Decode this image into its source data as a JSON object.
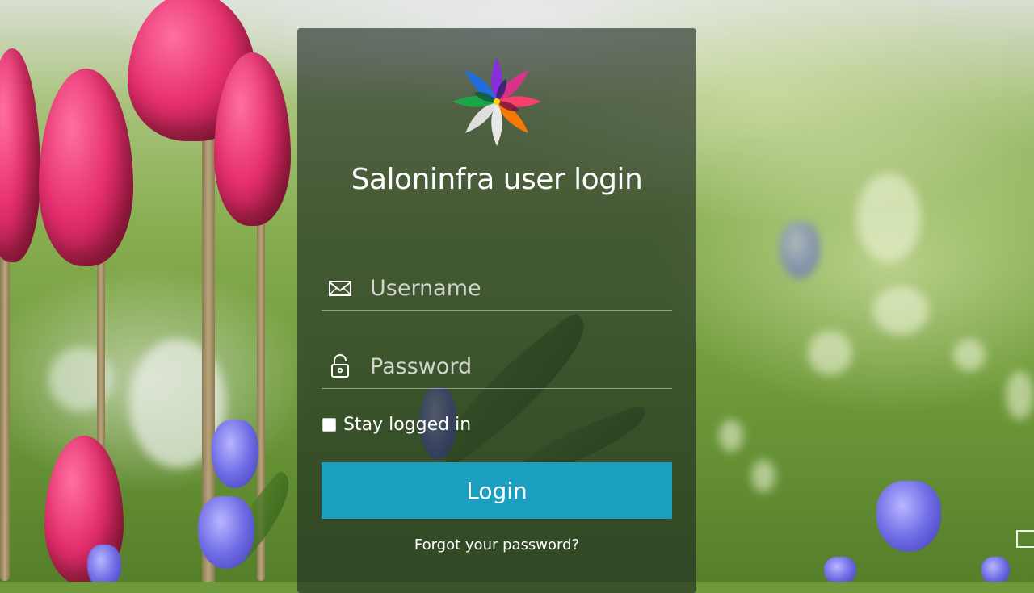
{
  "login": {
    "title": "Saloninfra user login",
    "username": {
      "placeholder": "Username",
      "value": ""
    },
    "password": {
      "placeholder": "Password",
      "value": ""
    },
    "remember_label": "Stay logged in",
    "remember_checked": false,
    "login_label": "Login",
    "forgot_label": "Forgot your password?"
  },
  "icons": {
    "logo": "flower-logo-icon",
    "username": "envelope-icon",
    "password": "unlock-icon"
  },
  "colors": {
    "button": "#1a9fc0",
    "panel": "rgba(28,38,34,0.62)",
    "text": "#ffffff"
  }
}
